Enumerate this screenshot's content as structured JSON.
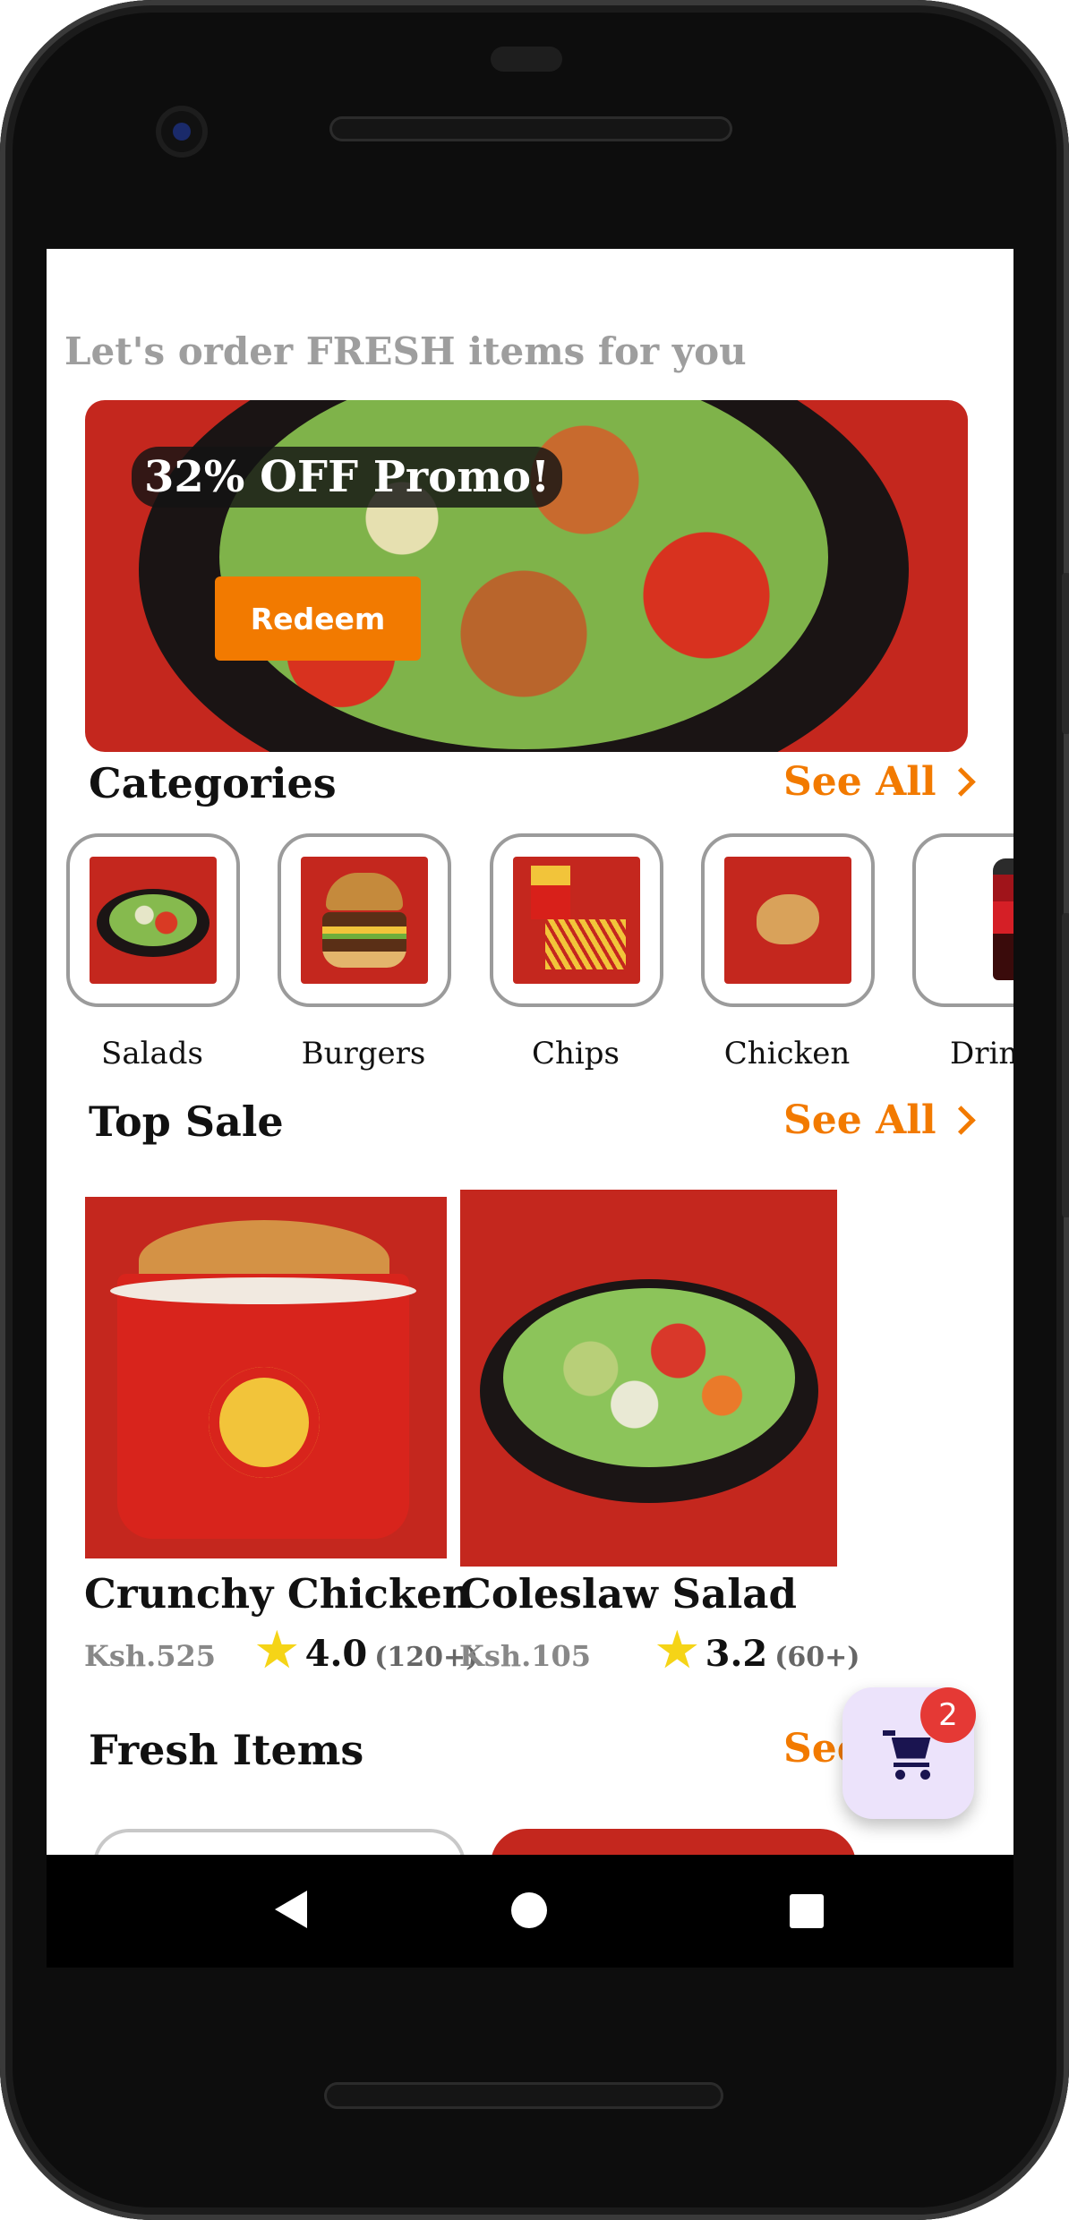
{
  "header": {
    "greeting": "Let's order FRESH items for you"
  },
  "promo": {
    "tag": "32% OFF Promo!",
    "button_label": "Redeem"
  },
  "categories": {
    "title": "Categories",
    "see_all": "See All",
    "items": [
      {
        "label": "Salads"
      },
      {
        "label": "Burgers"
      },
      {
        "label": "Chips"
      },
      {
        "label": "Chicken"
      },
      {
        "label": "Drin"
      }
    ]
  },
  "top_sale": {
    "title": "Top Sale",
    "see_all": "See All",
    "products": [
      {
        "name": "Crunchy Chicken",
        "price": "Ksh.525",
        "rating": "4.0",
        "reviews": "(120+)"
      },
      {
        "name": "Coleslaw Salad",
        "price": "Ksh.105",
        "rating": "3.2",
        "reviews": "(60+)"
      }
    ]
  },
  "fresh_items": {
    "title": "Fresh Items",
    "see_all": "See"
  },
  "cart": {
    "count": "2"
  },
  "colors": {
    "accent": "#f27a00",
    "brand_red": "#c4271e",
    "badge": "#e53935"
  }
}
